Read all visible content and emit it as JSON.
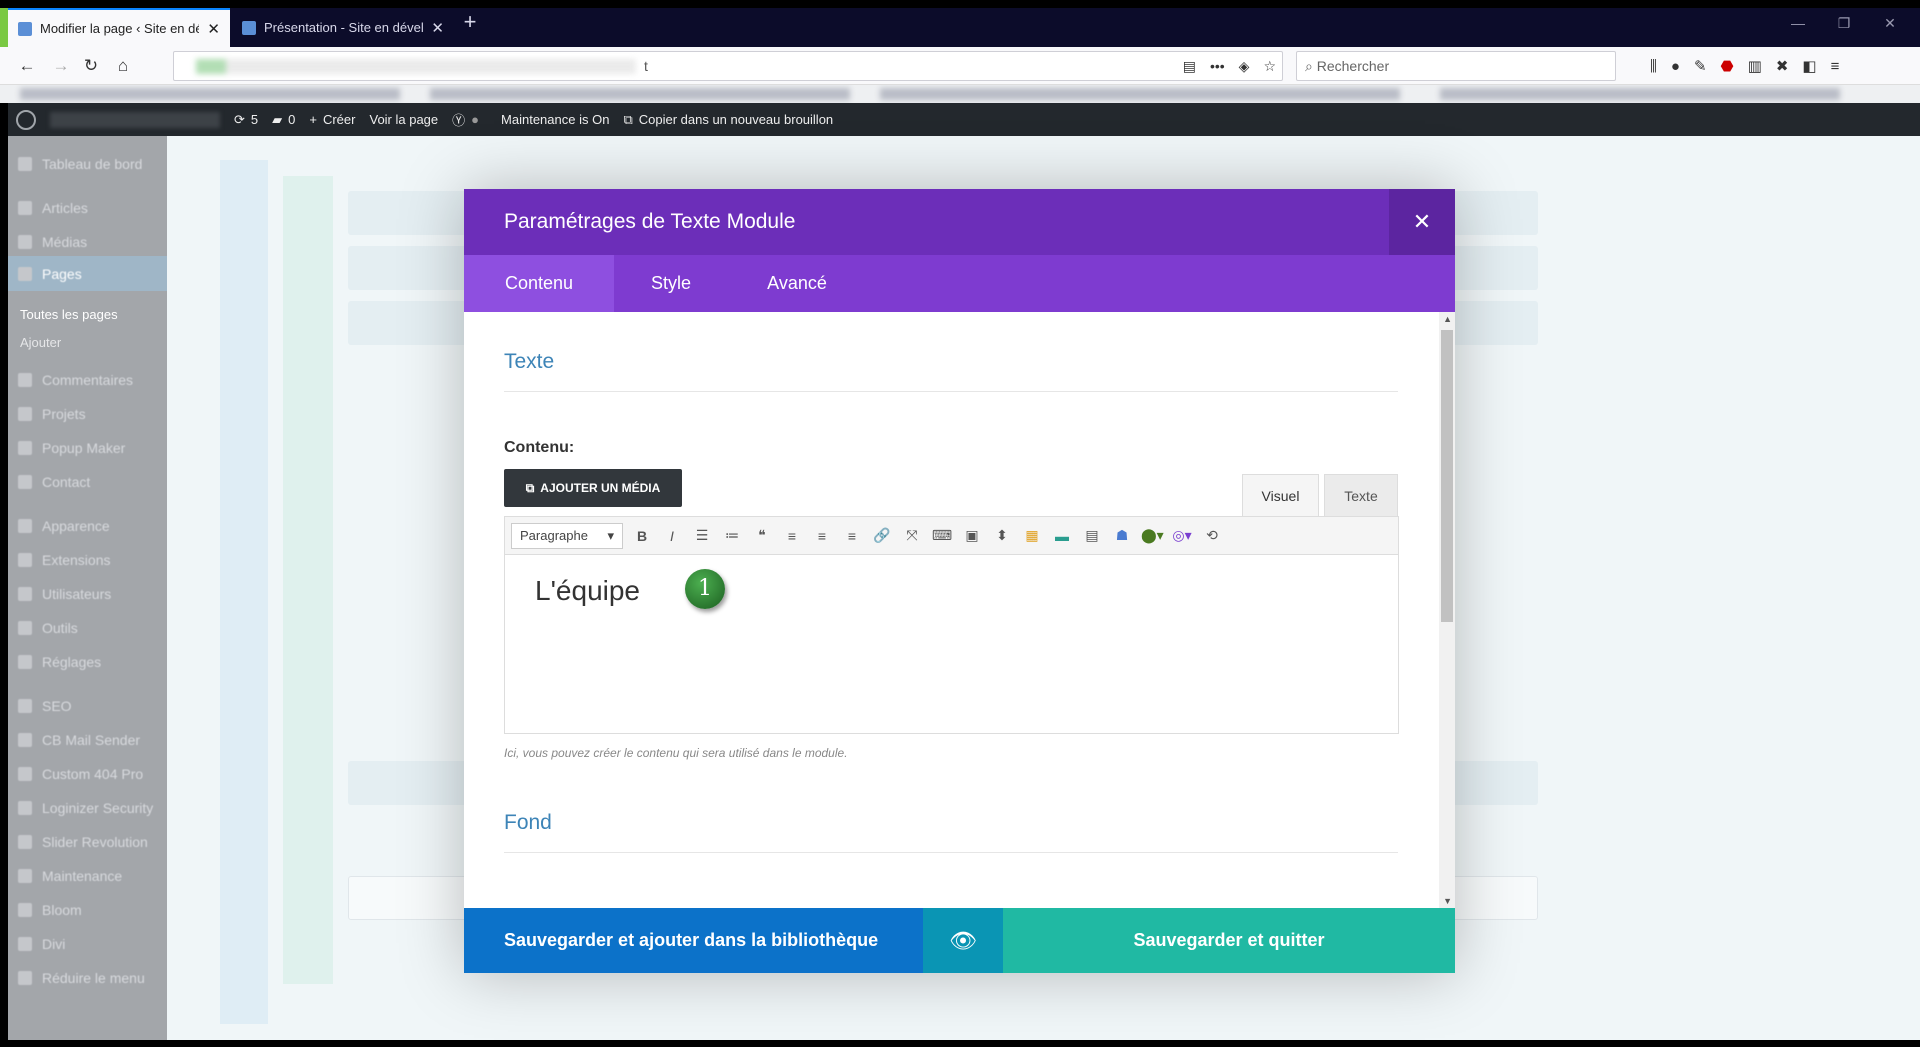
{
  "browser": {
    "tabs": [
      {
        "title": "Modifier la page ‹ Site en dével",
        "active": true
      },
      {
        "title": "Présentation - Site en développ",
        "active": false
      }
    ],
    "new_tab_icon": "plus-icon",
    "url_visible": "t",
    "search_placeholder": "Rechercher"
  },
  "admin_bar": {
    "updates_count": "5",
    "comments_count": "0",
    "create_label": "Créer",
    "view_page_label": "Voir la page",
    "maintenance_label": "Maintenance is On",
    "copy_draft_label": "Copier dans un nouveau brouillon"
  },
  "sidebar": {
    "items": [
      {
        "label": "Tableau de bord"
      },
      {
        "label": "Articles"
      },
      {
        "label": "Médias"
      },
      {
        "label": "Pages"
      },
      {
        "label": "Toutes les pages"
      },
      {
        "label": "Ajouter"
      },
      {
        "label": "Commentaires"
      },
      {
        "label": "Projets"
      },
      {
        "label": "Popup Maker"
      },
      {
        "label": "Contact"
      },
      {
        "label": "Apparence"
      },
      {
        "label": "Extensions"
      },
      {
        "label": "Utilisateurs"
      },
      {
        "label": "Outils"
      },
      {
        "label": "Réglages"
      },
      {
        "label": "SEO"
      },
      {
        "label": "CB Mail Sender"
      },
      {
        "label": "Custom 404 Pro"
      },
      {
        "label": "Loginizer Security"
      },
      {
        "label": "Slider Revolution"
      },
      {
        "label": "Maintenance"
      },
      {
        "label": "Bloom"
      },
      {
        "label": "Divi"
      },
      {
        "label": "Réduire le menu"
      }
    ]
  },
  "modal": {
    "title": "Paramétrages de Texte Module",
    "close_icon": "close-icon",
    "tabs": [
      {
        "label": "Contenu"
      },
      {
        "label": "Style"
      },
      {
        "label": "Avancé"
      }
    ],
    "section_text_title": "Texte",
    "content_label": "Contenu:",
    "add_media_label": "AJOUTER UN MÉDIA",
    "editor_tabs": {
      "visual": "Visuel",
      "text": "Texte"
    },
    "format_select": "Paragraphe",
    "editor_content": "L'équipe",
    "badge_number": "1",
    "help_text": "Ici, vous pouvez créer le contenu qui sera utilisé dans le module.",
    "section_background_title": "Fond",
    "footer": {
      "save_library_label": "Sauvegarder et ajouter dans la bibliothèque",
      "preview_icon": "eye-icon",
      "save_quit_label": "Sauvegarder et quitter"
    }
  },
  "colors": {
    "modal_header": "#6c2eb9",
    "modal_tabs": "#7e3bd0",
    "save_library": "#0c72c9",
    "save_quit": "#20b9a3",
    "section_title": "#3d84b7"
  }
}
